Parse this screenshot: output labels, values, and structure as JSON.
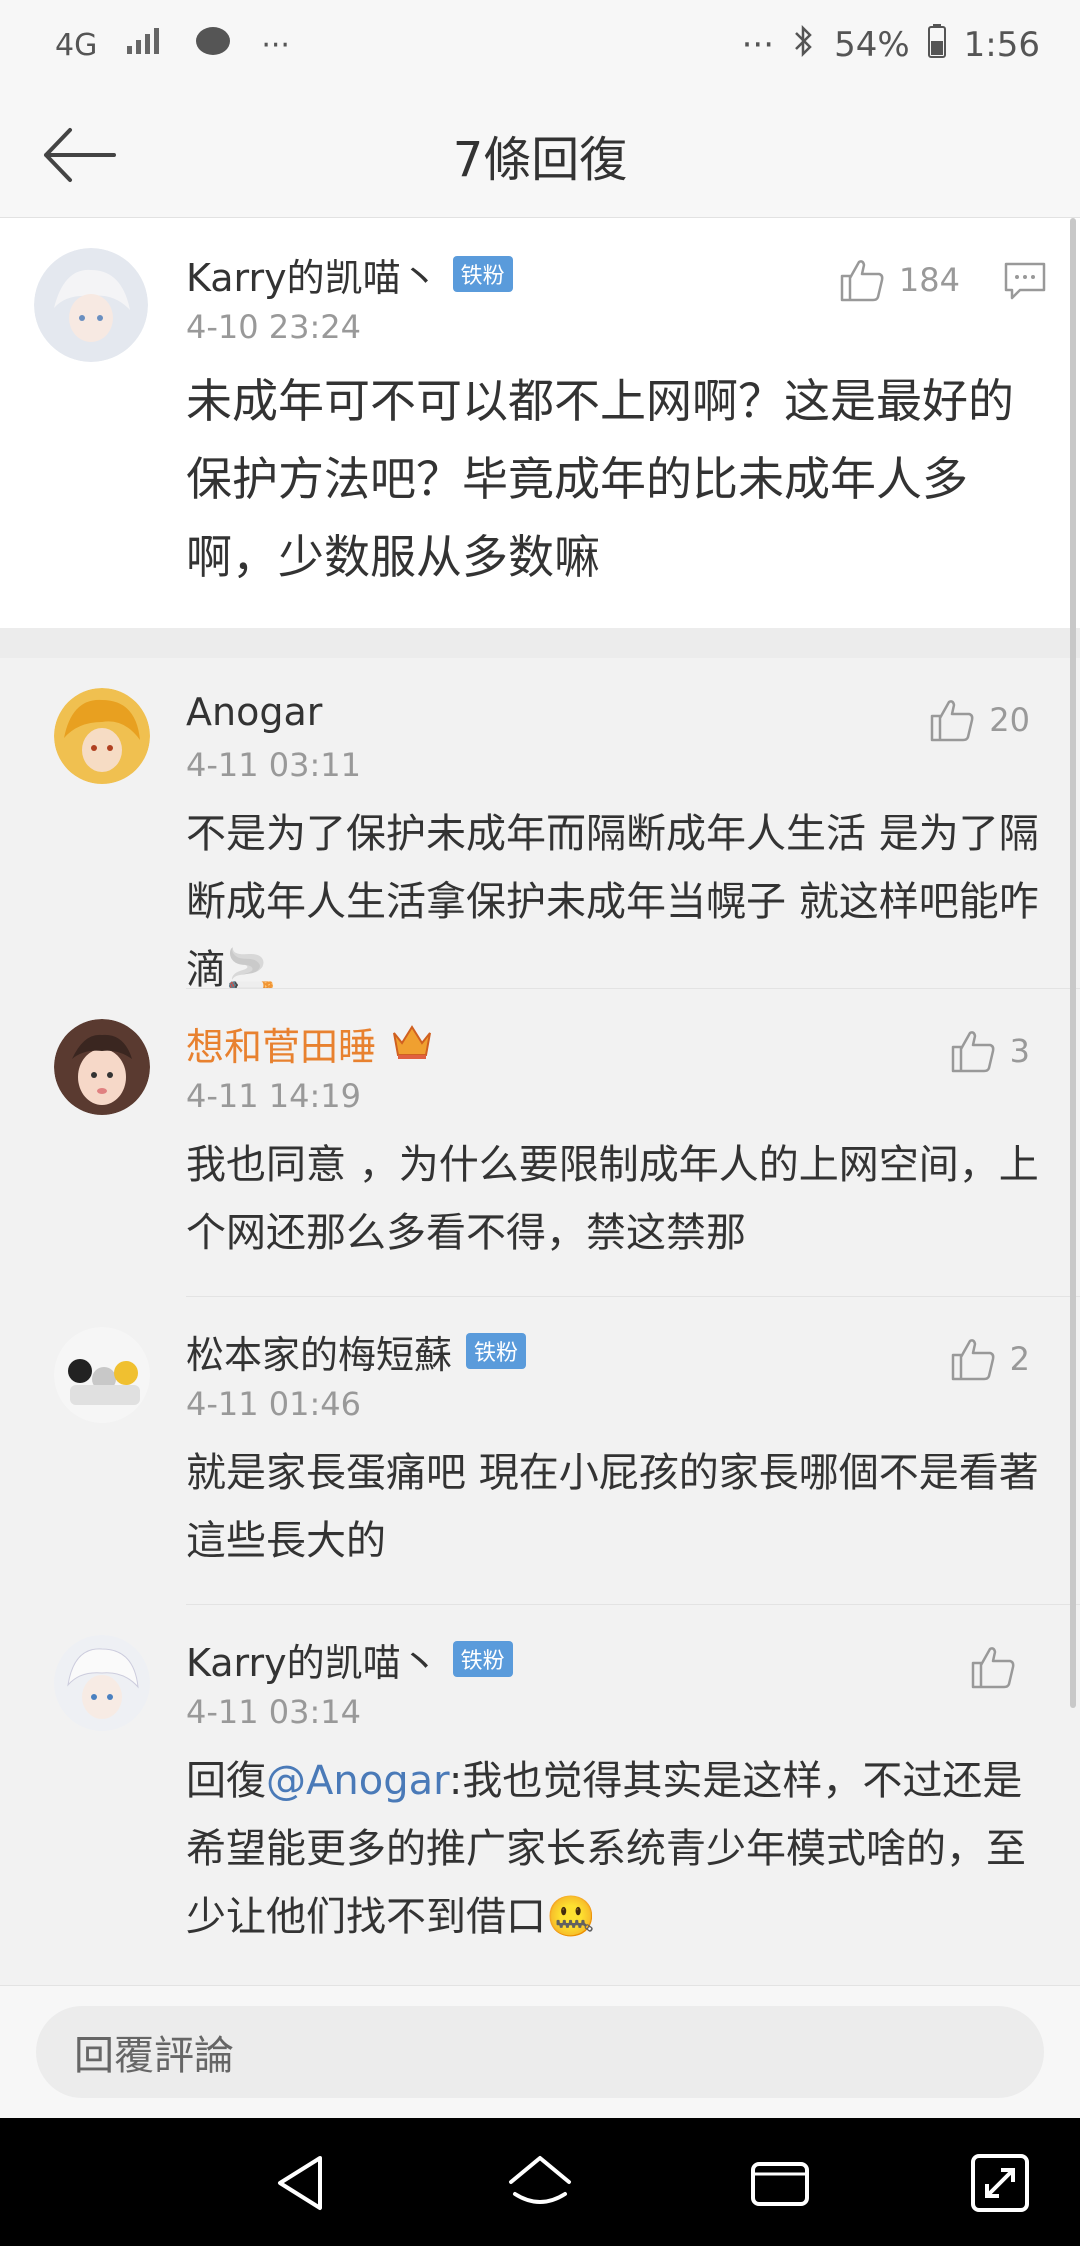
{
  "status_bar": {
    "network": "4G",
    "battery": "54%",
    "time": "1:56",
    "more": "···"
  },
  "header": {
    "title": "7條回復"
  },
  "main_comment": {
    "user": "Karry的凯喵丶",
    "badge": "铁粉",
    "time": "4-10 23:24",
    "likes": "184",
    "text": "未成年可不可以都不上网啊？这是最好的保护方法吧？毕竟成年的比未成年人多啊，少数服从多数嘛"
  },
  "replies": [
    {
      "user": "Anogar",
      "badge": "",
      "time": "4-11 03:11",
      "likes": "20",
      "text": "不是为了保护未成年而隔断成年人生活 是为了隔断成年人生活拿保护未成年当幌子 就这样吧能咋滴🚬"
    },
    {
      "user": "想和菅田睡",
      "badge": "",
      "time": "4-11 14:19",
      "likes": "3",
      "text": "我也同意 ，为什么要限制成年人的上网空间，上个网还那么多看不得，禁这禁那"
    },
    {
      "user": "松本家的梅短蘇",
      "badge": "铁粉",
      "time": "4-11 01:46",
      "likes": "2",
      "text": "就是家長蛋痛吧 現在小屁孩的家長哪個不是看著這些長大的"
    },
    {
      "user": "Karry的凯喵丶",
      "badge": "铁粉",
      "time": "4-11 03:14",
      "likes": "",
      "prefix": "回復",
      "mention": "@Anogar",
      "text": ":我也觉得其实是这样，不过还是希望能更多的推广家长系统青少年模式啥的，至少让他们找不到借口🤐"
    }
  ],
  "input": {
    "placeholder": "回覆評論"
  }
}
